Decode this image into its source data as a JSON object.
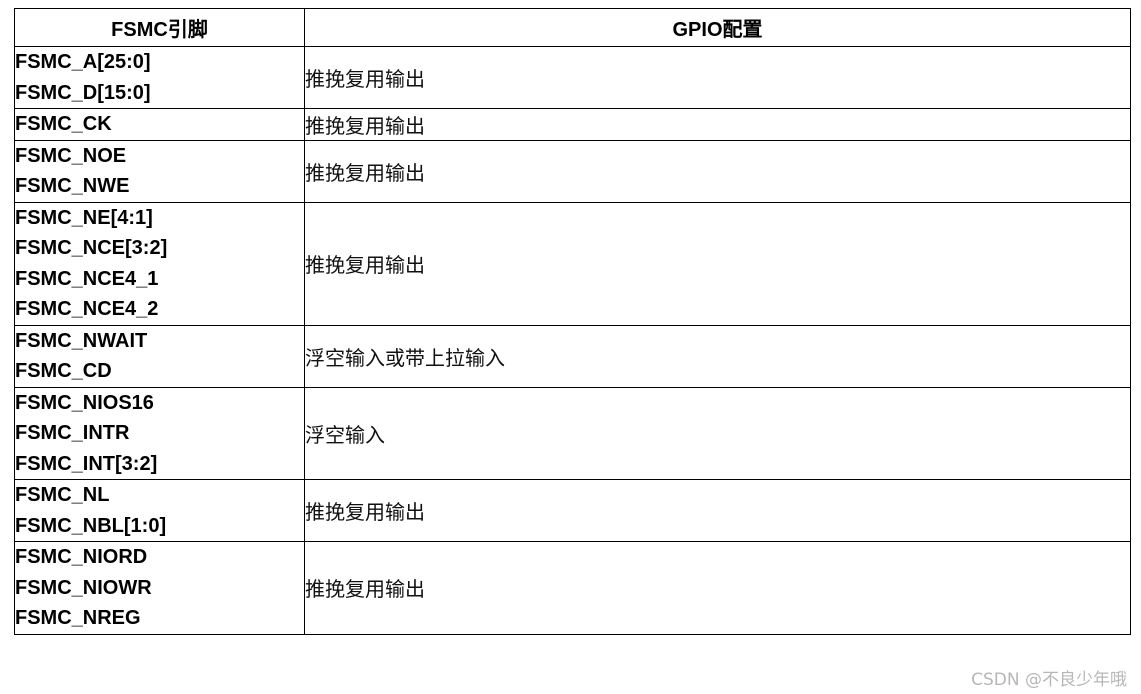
{
  "table": {
    "headers": {
      "pin": "FSMC引脚",
      "config": "GPIO配置"
    },
    "rows": [
      {
        "pins": [
          "FSMC_A[25:0]",
          "FSMC_D[15:0]"
        ],
        "config": "推挽复用输出"
      },
      {
        "pins": [
          "FSMC_CK"
        ],
        "config": "推挽复用输出"
      },
      {
        "pins": [
          "FSMC_NOE",
          "FSMC_NWE"
        ],
        "config": "推挽复用输出"
      },
      {
        "pins": [
          "FSMC_NE[4:1]",
          "FSMC_NCE[3:2]",
          "FSMC_NCE4_1",
          "FSMC_NCE4_2"
        ],
        "config": "推挽复用输出"
      },
      {
        "pins": [
          "FSMC_NWAIT",
          "FSMC_CD"
        ],
        "config": "浮空输入或带上拉输入"
      },
      {
        "pins": [
          "FSMC_NIOS16",
          "FSMC_INTR",
          "FSMC_INT[3:2]"
        ],
        "config": "浮空输入"
      },
      {
        "pins": [
          "FSMC_NL",
          "FSMC_NBL[1:0]"
        ],
        "config": "推挽复用输出"
      },
      {
        "pins": [
          "FSMC_NIORD",
          "FSMC_NIOWR",
          "FSMC_NREG"
        ],
        "config": "推挽复用输出"
      }
    ]
  },
  "watermark": "CSDN @不良少年哦"
}
